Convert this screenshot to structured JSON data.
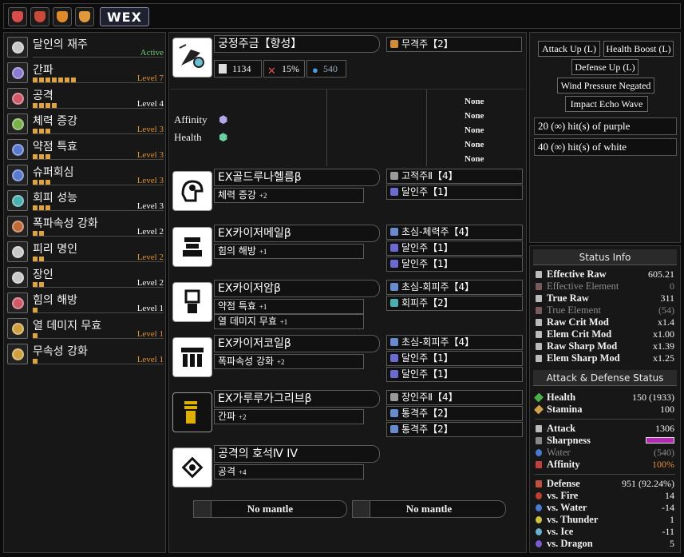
{
  "topbar": {
    "icons": [
      {
        "name": "quest-icon-1",
        "color": "#d94c4c"
      },
      {
        "name": "quest-icon-2",
        "color": "#c94a3a"
      },
      {
        "name": "quest-icon-3",
        "color": "#e08a2a"
      },
      {
        "name": "quest-icon-4",
        "color": "#e09a3a"
      }
    ],
    "wex_label": "WEX"
  },
  "skills": [
    {
      "name": "달인의 재주",
      "level_text": "Active",
      "level_color": "#6fd06f",
      "pips": 0,
      "icon_color": "#c8c8c8"
    },
    {
      "name": "간파",
      "level_text": "Level 7",
      "level_color": "#e0913a",
      "pips": 7,
      "icon_color": "#8a7ad0"
    },
    {
      "name": "공격",
      "level_text": "Level 4",
      "level_color": "#ffffff",
      "pips": 4,
      "icon_color": "#d05a6a"
    },
    {
      "name": "체력 증강",
      "level_text": "Level 3",
      "level_color": "#e0913a",
      "pips": 3,
      "icon_color": "#7ab04a"
    },
    {
      "name": "약점 특효",
      "level_text": "Level 3",
      "level_color": "#e0913a",
      "pips": 3,
      "icon_color": "#5a7ad0"
    },
    {
      "name": "슈퍼회심",
      "level_text": "Level 3",
      "level_color": "#e0913a",
      "pips": 3,
      "icon_color": "#5a7ad0"
    },
    {
      "name": "회피 성능",
      "level_text": "Level 3",
      "level_color": "#ffffff",
      "pips": 3,
      "icon_color": "#4ab0b0"
    },
    {
      "name": "폭파속성 강화",
      "level_text": "Level 2",
      "level_color": "#ffffff",
      "pips": 2,
      "icon_color": "#c06a3a"
    },
    {
      "name": "피리 명인",
      "level_text": "Level 2",
      "level_color": "#e0913a",
      "pips": 2,
      "icon_color": "#c8c8c8"
    },
    {
      "name": "장인",
      "level_text": "Level 2",
      "level_color": "#ffffff",
      "pips": 2,
      "icon_color": "#c8c8c8"
    },
    {
      "name": "힘의 해방",
      "level_text": "Level 1",
      "level_color": "#ffffff",
      "pips": 1,
      "icon_color": "#d05a6a"
    },
    {
      "name": "열 데미지 무효",
      "level_text": "Level 1",
      "level_color": "#e0913a",
      "pips": 1,
      "icon_color": "#d0a040"
    },
    {
      "name": "무속성 강화",
      "level_text": "Level 1",
      "level_color": "#e0913a",
      "pips": 1,
      "icon_color": "#d0a040"
    }
  ],
  "weapon": {
    "name": "궁정주금【향성】",
    "attack": "1134",
    "affinity": "15%",
    "element": "540",
    "deco": "무격주【2】",
    "affinity_label": "Affinity",
    "health_label": "Health",
    "none_values": [
      "None",
      "None",
      "None",
      "None",
      "None"
    ]
  },
  "armor": [
    {
      "name": "EX골드루나헬름β",
      "skills": [
        {
          "name": "체력 증강",
          "level": "+2"
        }
      ],
      "decos": [
        {
          "label": "고적주Ⅱ【4】",
          "color": "#9a9a9a"
        },
        {
          "label": "달인주【1】",
          "color": "#6a6ad0"
        }
      ]
    },
    {
      "name": "EX카이저메일β",
      "skills": [
        {
          "name": "힘의 해방",
          "level": "+1"
        }
      ],
      "decos": [
        {
          "label": "초심-체력주【4】",
          "color": "#6a8ad0"
        },
        {
          "label": "달인주【1】",
          "color": "#6a6ad0"
        },
        {
          "label": "달인주【1】",
          "color": "#6a6ad0"
        }
      ]
    },
    {
      "name": "EX카이저암β",
      "skills": [
        {
          "name": "약점 특효",
          "level": "+1"
        },
        {
          "name": "열 데미지 무효",
          "level": "+1"
        }
      ],
      "decos": [
        {
          "label": "초심-회피주【4】",
          "color": "#6a8ad0"
        },
        {
          "label": "회피주【2】",
          "color": "#4ab0b0"
        }
      ]
    },
    {
      "name": "EX카이저코일β",
      "skills": [
        {
          "name": "폭파속성 강화",
          "level": "+2"
        }
      ],
      "decos": [
        {
          "label": "초심-회피주【4】",
          "color": "#6a8ad0"
        },
        {
          "label": "달인주【1】",
          "color": "#6a6ad0"
        },
        {
          "label": "달인주【1】",
          "color": "#6a6ad0"
        }
      ]
    },
    {
      "name": "EX가루루가그리브β",
      "skills": [
        {
          "name": "간파",
          "level": "+2"
        }
      ],
      "decos": [
        {
          "label": "장인주Ⅱ【4】",
          "color": "#9a9a9a"
        },
        {
          "label": "통격주【2】",
          "color": "#6a8ad0"
        },
        {
          "label": "통격주【2】",
          "color": "#6a8ad0"
        }
      ]
    },
    {
      "name": "공격의 호석Ⅳ IV",
      "skills": [
        {
          "name": "공격",
          "level": "+4"
        }
      ],
      "decos": []
    }
  ],
  "mantles": [
    "No mantle",
    "No mantle"
  ],
  "buffs": [
    "Attack Up (L)",
    "Health Boost (L)",
    "Defense Up (L)",
    "Wind Pressure Negated",
    "Impact Echo Wave"
  ],
  "hits": [
    "20 (∞) hit(s) of purple",
    "40 (∞) hit(s) of white"
  ],
  "status": {
    "title": "Status Info",
    "rows": [
      {
        "label": "Effective Raw",
        "value": "605.21",
        "dim": false
      },
      {
        "label": "Effective Element",
        "value": "0",
        "dim": true
      },
      {
        "label": "True Raw",
        "value": "311",
        "dim": false
      },
      {
        "label": "True Element",
        "value": "(54)",
        "dim": true
      },
      {
        "label": "Raw Crit Mod",
        "value": "x1.4",
        "dim": false
      },
      {
        "label": "Elem Crit Mod",
        "value": "x1.00",
        "dim": false
      },
      {
        "label": "Raw Sharp Mod",
        "value": "x1.39",
        "dim": false
      },
      {
        "label": "Elem Sharp Mod",
        "value": "x1.25",
        "dim": false
      }
    ],
    "ad_title": "Attack & Defense Status",
    "health": {
      "label": "Health",
      "value": "150 (1933)"
    },
    "stamina": {
      "label": "Stamina",
      "value": "100"
    },
    "attack": {
      "label": "Attack",
      "value": "1306"
    },
    "sharpness": {
      "label": "Sharpness",
      "color": "#b02ab0"
    },
    "water": {
      "label": "Water",
      "value": "(540)"
    },
    "affinity": {
      "label": "Affinity",
      "value": "100%"
    },
    "defense": {
      "label": "Defense",
      "value": "951 (92.24%)"
    },
    "resists": [
      {
        "label": "vs. Fire",
        "value": "14"
      },
      {
        "label": "vs. Water",
        "value": "-14"
      },
      {
        "label": "vs. Thunder",
        "value": "1"
      },
      {
        "label": "vs. Ice",
        "value": "-11"
      },
      {
        "label": "vs. Dragon",
        "value": "5"
      }
    ]
  }
}
